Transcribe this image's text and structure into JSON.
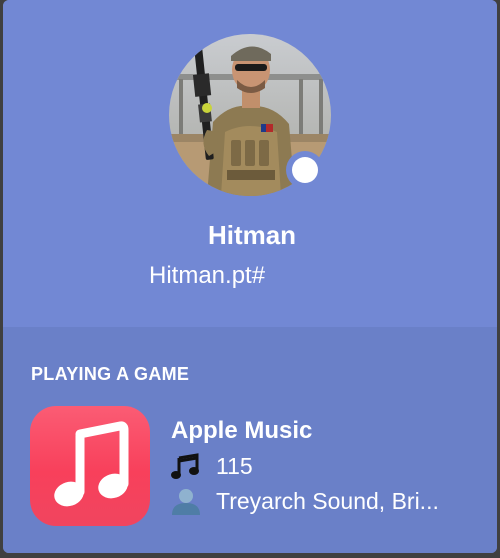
{
  "profile": {
    "username": "Hitman",
    "tag": "Hitman.pt#",
    "status": "online"
  },
  "activity": {
    "section_title": "PLAYING A GAME",
    "app_name": "Apple Music",
    "track_count": "115",
    "artist": "Treyarch Sound, Bri..."
  },
  "icons": {
    "music": "music-note-icon",
    "person": "person-icon",
    "app": "apple-music-icon"
  },
  "colors": {
    "header_bg": "#7288d4",
    "activity_bg": "#6a80c8",
    "app_icon": "#f8405b",
    "status": "#ffffff"
  }
}
